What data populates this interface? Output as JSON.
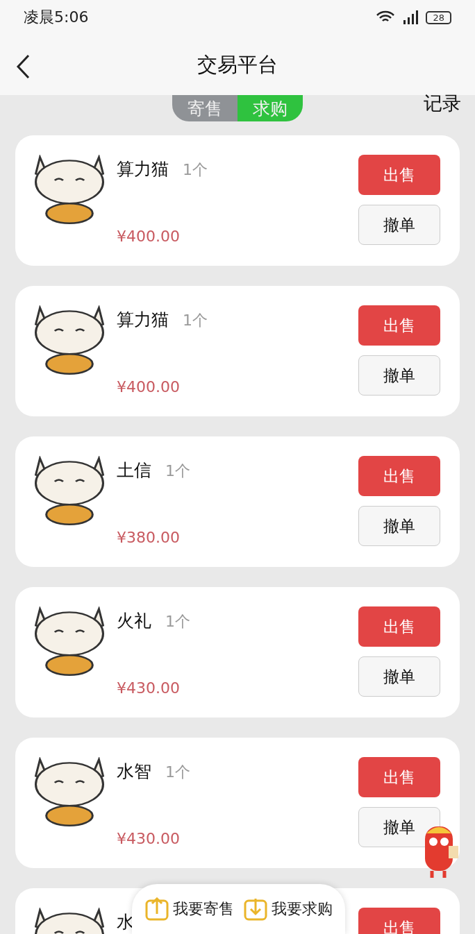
{
  "status_bar": {
    "time": "凌晨5:06",
    "battery": "28"
  },
  "header": {
    "title": "交易平台"
  },
  "tabs": [
    {
      "label": "寄售",
      "selected": false
    },
    {
      "label": "求购",
      "selected": true
    }
  ],
  "records_link": "记录",
  "items": [
    {
      "name": "算力猫",
      "count": "1个",
      "price": "¥400.00",
      "sell": "出售",
      "cancel": "撤单"
    },
    {
      "name": "算力猫",
      "count": "1个",
      "price": "¥400.00",
      "sell": "出售",
      "cancel": "撤单"
    },
    {
      "name": "土信",
      "count": "1个",
      "price": "¥380.00",
      "sell": "出售",
      "cancel": "撤单"
    },
    {
      "name": "火礼",
      "count": "1个",
      "price": "¥430.00",
      "sell": "出售",
      "cancel": "撤单"
    },
    {
      "name": "水智",
      "count": "1个",
      "price": "¥430.00",
      "sell": "出售",
      "cancel": "撤单"
    },
    {
      "name": "水",
      "sell": "出售"
    }
  ],
  "bottom_actions": [
    {
      "label": "我要寄售",
      "kind": "upload"
    },
    {
      "label": "我要求购",
      "kind": "download"
    }
  ]
}
